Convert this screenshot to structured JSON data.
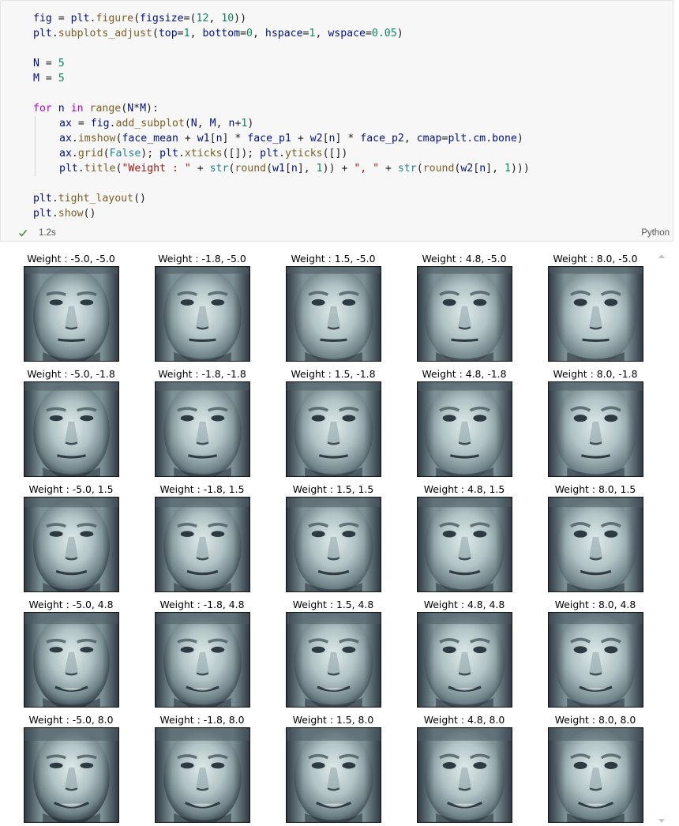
{
  "code_cell": {
    "lines": [
      [
        {
          "t": "fig",
          "c": "var"
        },
        {
          "t": " = ",
          "c": "op"
        },
        {
          "t": "plt",
          "c": "var"
        },
        {
          "t": ".",
          "c": "op"
        },
        {
          "t": "figure",
          "c": "fn"
        },
        {
          "t": "(",
          "c": "op"
        },
        {
          "t": "figsize",
          "c": "var"
        },
        {
          "t": "=(",
          "c": "op"
        },
        {
          "t": "12",
          "c": "num"
        },
        {
          "t": ", ",
          "c": "op"
        },
        {
          "t": "10",
          "c": "num"
        },
        {
          "t": "))",
          "c": "op"
        }
      ],
      [
        {
          "t": "plt",
          "c": "var"
        },
        {
          "t": ".",
          "c": "op"
        },
        {
          "t": "subplots_adjust",
          "c": "fn"
        },
        {
          "t": "(",
          "c": "op"
        },
        {
          "t": "top",
          "c": "var"
        },
        {
          "t": "=",
          "c": "op"
        },
        {
          "t": "1",
          "c": "num"
        },
        {
          "t": ", ",
          "c": "op"
        },
        {
          "t": "bottom",
          "c": "var"
        },
        {
          "t": "=",
          "c": "op"
        },
        {
          "t": "0",
          "c": "num"
        },
        {
          "t": ", ",
          "c": "op"
        },
        {
          "t": "hspace",
          "c": "var"
        },
        {
          "t": "=",
          "c": "op"
        },
        {
          "t": "1",
          "c": "num"
        },
        {
          "t": ", ",
          "c": "op"
        },
        {
          "t": "wspace",
          "c": "var"
        },
        {
          "t": "=",
          "c": "op"
        },
        {
          "t": "0.05",
          "c": "num"
        },
        {
          "t": ")",
          "c": "op"
        }
      ],
      [],
      [
        {
          "t": "N",
          "c": "var"
        },
        {
          "t": " = ",
          "c": "op"
        },
        {
          "t": "5",
          "c": "num"
        }
      ],
      [
        {
          "t": "M",
          "c": "var"
        },
        {
          "t": " = ",
          "c": "op"
        },
        {
          "t": "5",
          "c": "num"
        }
      ],
      [],
      [
        {
          "t": "for",
          "c": "kw"
        },
        {
          "t": " ",
          "c": "op"
        },
        {
          "t": "n",
          "c": "var"
        },
        {
          "t": " ",
          "c": "op"
        },
        {
          "t": "in",
          "c": "kw"
        },
        {
          "t": " ",
          "c": "op"
        },
        {
          "t": "range",
          "c": "fn"
        },
        {
          "t": "(",
          "c": "op"
        },
        {
          "t": "N",
          "c": "var"
        },
        {
          "t": "*",
          "c": "op"
        },
        {
          "t": "M",
          "c": "var"
        },
        {
          "t": "):",
          "c": "op"
        }
      ],
      [
        {
          "indent": true
        },
        {
          "t": "ax",
          "c": "var"
        },
        {
          "t": " = ",
          "c": "op"
        },
        {
          "t": "fig",
          "c": "var"
        },
        {
          "t": ".",
          "c": "op"
        },
        {
          "t": "add_subplot",
          "c": "fn"
        },
        {
          "t": "(",
          "c": "op"
        },
        {
          "t": "N",
          "c": "var"
        },
        {
          "t": ", ",
          "c": "op"
        },
        {
          "t": "M",
          "c": "var"
        },
        {
          "t": ", ",
          "c": "op"
        },
        {
          "t": "n",
          "c": "var"
        },
        {
          "t": "+",
          "c": "op"
        },
        {
          "t": "1",
          "c": "num"
        },
        {
          "t": ")",
          "c": "op"
        }
      ],
      [
        {
          "indent": true
        },
        {
          "t": "ax",
          "c": "var"
        },
        {
          "t": ".",
          "c": "op"
        },
        {
          "t": "imshow",
          "c": "fn"
        },
        {
          "t": "(",
          "c": "op"
        },
        {
          "t": "face_mean",
          "c": "var"
        },
        {
          "t": " + ",
          "c": "op"
        },
        {
          "t": "w1",
          "c": "var"
        },
        {
          "t": "[",
          "c": "op"
        },
        {
          "t": "n",
          "c": "var"
        },
        {
          "t": "] * ",
          "c": "op"
        },
        {
          "t": "face_p1",
          "c": "var"
        },
        {
          "t": " + ",
          "c": "op"
        },
        {
          "t": "w2",
          "c": "var"
        },
        {
          "t": "[",
          "c": "op"
        },
        {
          "t": "n",
          "c": "var"
        },
        {
          "t": "] * ",
          "c": "op"
        },
        {
          "t": "face_p2",
          "c": "var"
        },
        {
          "t": ", ",
          "c": "op"
        },
        {
          "t": "cmap",
          "c": "var"
        },
        {
          "t": "=",
          "c": "op"
        },
        {
          "t": "plt",
          "c": "var"
        },
        {
          "t": ".",
          "c": "op"
        },
        {
          "t": "cm",
          "c": "var"
        },
        {
          "t": ".",
          "c": "op"
        },
        {
          "t": "bone",
          "c": "var"
        },
        {
          "t": ")",
          "c": "op"
        }
      ],
      [
        {
          "indent": true
        },
        {
          "t": "ax",
          "c": "var"
        },
        {
          "t": ".",
          "c": "op"
        },
        {
          "t": "grid",
          "c": "fn"
        },
        {
          "t": "(",
          "c": "op"
        },
        {
          "t": "False",
          "c": "cls"
        },
        {
          "t": "); ",
          "c": "op"
        },
        {
          "t": "plt",
          "c": "var"
        },
        {
          "t": ".",
          "c": "op"
        },
        {
          "t": "xticks",
          "c": "fn"
        },
        {
          "t": "([]); ",
          "c": "op"
        },
        {
          "t": "plt",
          "c": "var"
        },
        {
          "t": ".",
          "c": "op"
        },
        {
          "t": "yticks",
          "c": "fn"
        },
        {
          "t": "([])",
          "c": "op"
        }
      ],
      [
        {
          "indent": true
        },
        {
          "t": "plt",
          "c": "var"
        },
        {
          "t": ".",
          "c": "op"
        },
        {
          "t": "title",
          "c": "fn"
        },
        {
          "t": "(",
          "c": "op"
        },
        {
          "t": "\"Weight : \"",
          "c": "str"
        },
        {
          "t": " + ",
          "c": "op"
        },
        {
          "t": "str",
          "c": "cls"
        },
        {
          "t": "(",
          "c": "op"
        },
        {
          "t": "round",
          "c": "fn"
        },
        {
          "t": "(",
          "c": "op"
        },
        {
          "t": "w1",
          "c": "var"
        },
        {
          "t": "[",
          "c": "op"
        },
        {
          "t": "n",
          "c": "var"
        },
        {
          "t": "], ",
          "c": "op"
        },
        {
          "t": "1",
          "c": "num"
        },
        {
          "t": ")) + ",
          "c": "op"
        },
        {
          "t": "\", \"",
          "c": "str"
        },
        {
          "t": " + ",
          "c": "op"
        },
        {
          "t": "str",
          "c": "cls"
        },
        {
          "t": "(",
          "c": "op"
        },
        {
          "t": "round",
          "c": "fn"
        },
        {
          "t": "(",
          "c": "op"
        },
        {
          "t": "w2",
          "c": "var"
        },
        {
          "t": "[",
          "c": "op"
        },
        {
          "t": "n",
          "c": "var"
        },
        {
          "t": "], ",
          "c": "op"
        },
        {
          "t": "1",
          "c": "num"
        },
        {
          "t": ")))",
          "c": "op"
        }
      ],
      [],
      [
        {
          "t": "plt",
          "c": "var"
        },
        {
          "t": ".",
          "c": "op"
        },
        {
          "t": "tight_layout",
          "c": "fn"
        },
        {
          "t": "()",
          "c": "op"
        }
      ],
      [
        {
          "t": "plt",
          "c": "var"
        },
        {
          "t": ".",
          "c": "op"
        },
        {
          "t": "show",
          "c": "fn"
        },
        {
          "t": "()",
          "c": "op"
        }
      ]
    ]
  },
  "status": {
    "exec_time": "1.2s",
    "language": "Python",
    "check_color": "#388a34"
  },
  "output": {
    "titles": [
      "Weight : -5.0, -5.0",
      "Weight : -1.8, -5.0",
      "Weight : 1.5, -5.0",
      "Weight : 4.8, -5.0",
      "Weight : 8.0, -5.0",
      "Weight : -5.0, -1.8",
      "Weight : -1.8, -1.8",
      "Weight : 1.5, -1.8",
      "Weight : 4.8, -1.8",
      "Weight : 8.0, -1.8",
      "Weight : -5.0, 1.5",
      "Weight : -1.8, 1.5",
      "Weight : 1.5, 1.5",
      "Weight : 4.8, 1.5",
      "Weight : 8.0, 1.5",
      "Weight : -5.0, 4.8",
      "Weight : -1.8, 4.8",
      "Weight : 1.5, 4.8",
      "Weight : 4.8, 4.8",
      "Weight : 8.0, 4.8",
      "Weight : -5.0, 8.0",
      "Weight : -1.8, 8.0",
      "Weight : 1.5, 8.0",
      "Weight : 4.8, 8.0",
      "Weight : 8.0, 8.0"
    ],
    "w1": [
      -5.0,
      -1.8,
      1.5,
      4.8,
      8.0
    ],
    "w2": [
      -5.0,
      -1.8,
      1.5,
      4.8,
      8.0
    ],
    "colormap": "bone",
    "image_content": "face"
  }
}
